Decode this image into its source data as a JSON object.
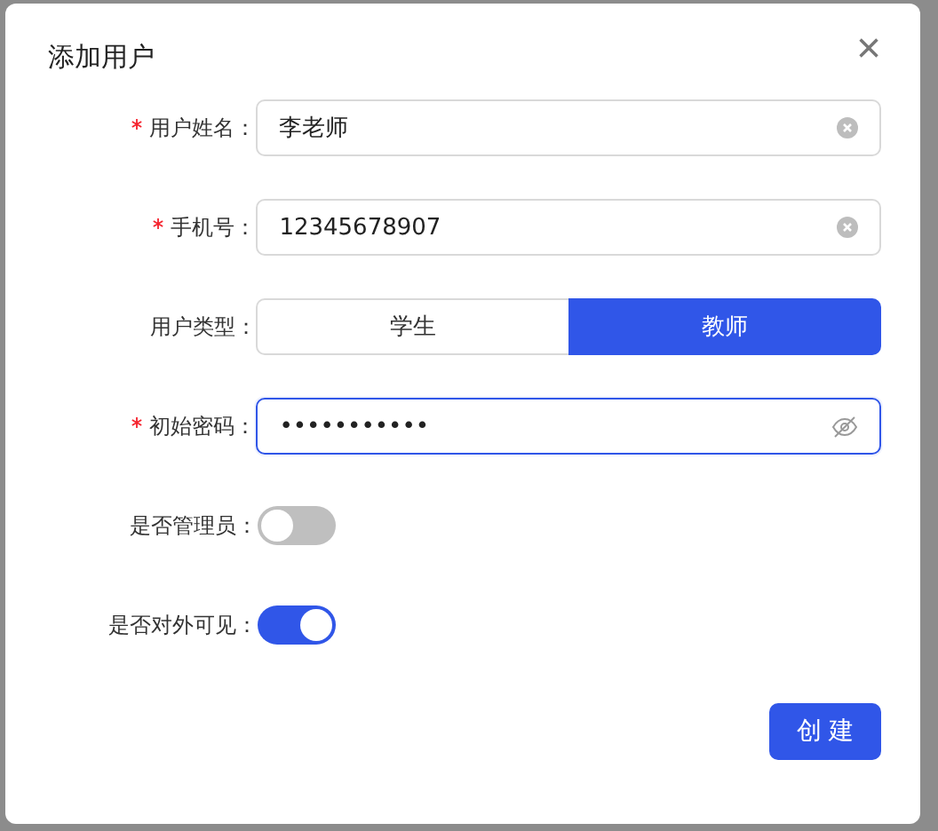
{
  "dialog": {
    "title": "添加用户",
    "close": "×"
  },
  "fields": [
    {
      "kind": "text",
      "label": "用户姓名：",
      "required": true,
      "value": "李老师",
      "clearable": true
    },
    {
      "kind": "text",
      "label": "手机号：",
      "required": true,
      "value": "12345678907",
      "clearable": true
    },
    {
      "kind": "segmented",
      "label": "用户类型：",
      "required": false,
      "options": [
        {
          "label": "学生",
          "selected": false
        },
        {
          "label": "教师",
          "selected": true
        }
      ]
    },
    {
      "kind": "password",
      "label": "初始密码：",
      "required": true,
      "value": "•••••••••••",
      "focused": true
    },
    {
      "kind": "switch",
      "label": "是否管理员：",
      "required": false,
      "on": false
    },
    {
      "kind": "switch",
      "label": "是否对外可见：",
      "required": false,
      "on": true
    }
  ],
  "submit": "创 建"
}
